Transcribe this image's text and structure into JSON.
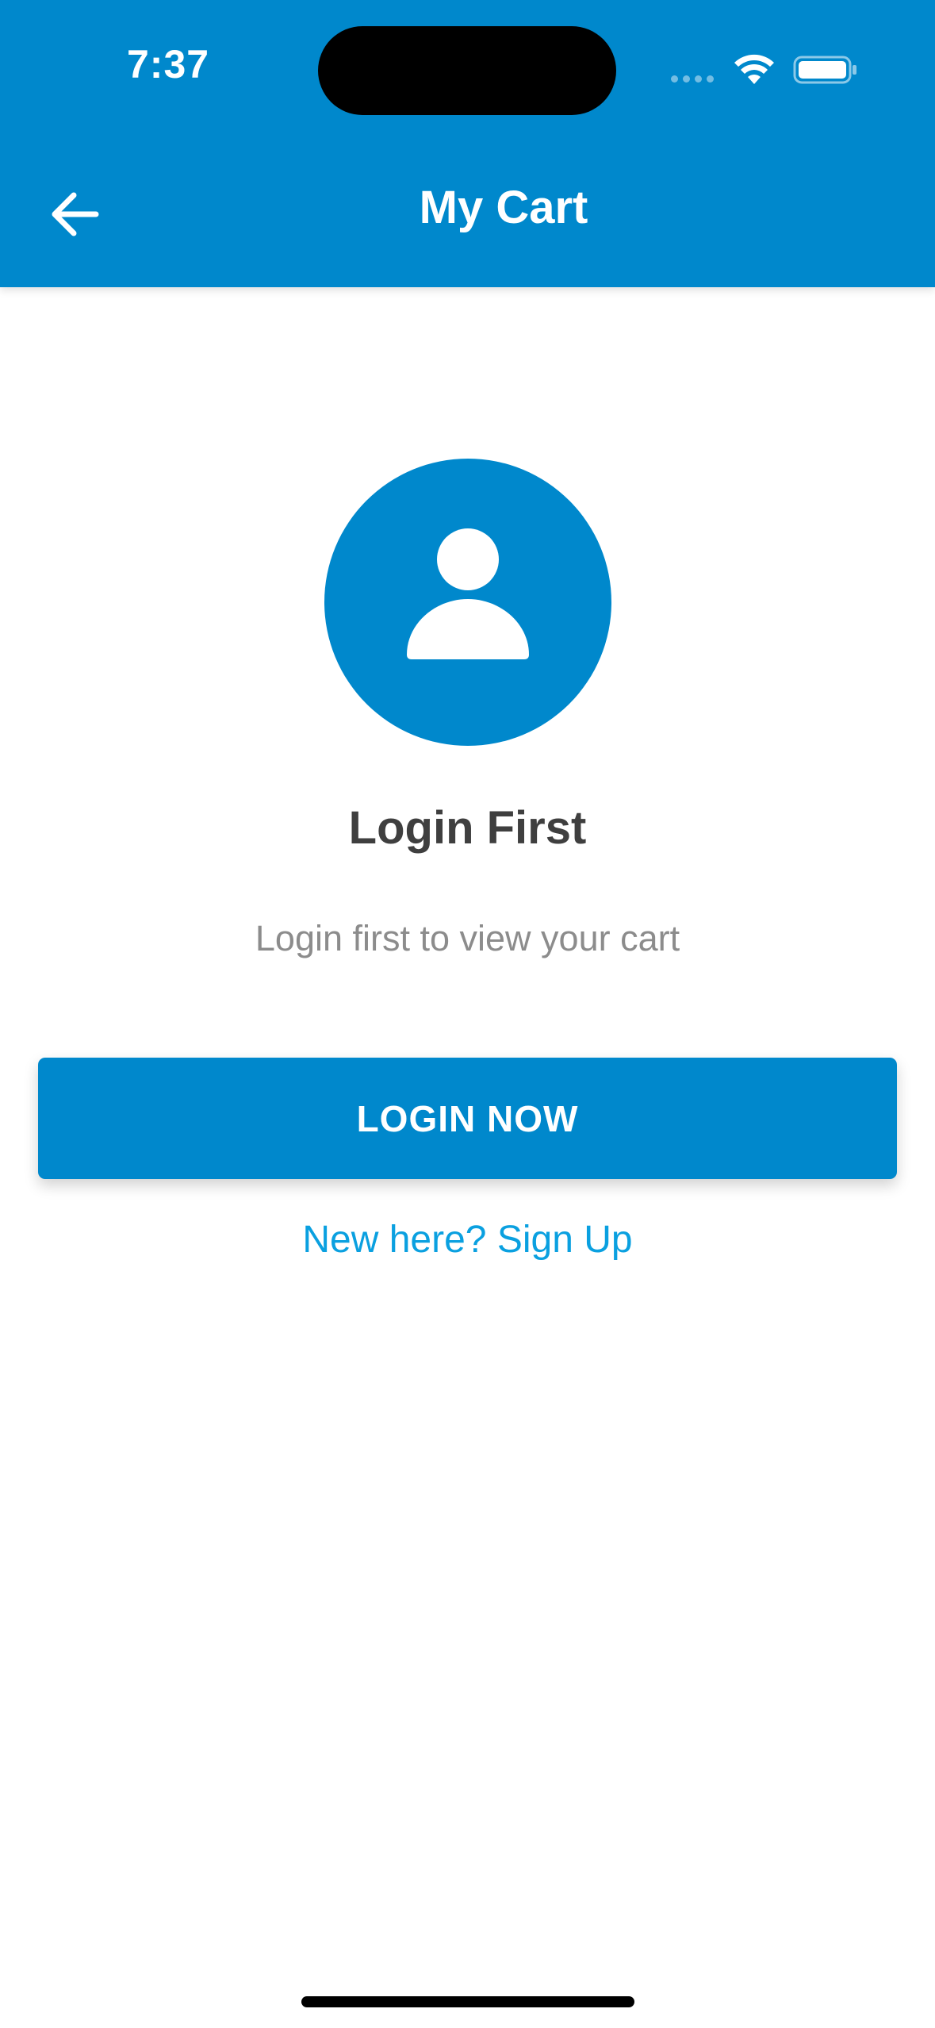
{
  "status_bar": {
    "time": "7:37",
    "icons": [
      "cellular-signal-icon",
      "wifi-icon",
      "battery-icon"
    ]
  },
  "header": {
    "title": "My Cart",
    "back_icon": "arrow-left-icon",
    "background_color": "#0088CC"
  },
  "main": {
    "avatar_icon": "user-icon",
    "heading": "Login First",
    "subtext": "Login first to view your cart",
    "login_button_label": "LOGIN NOW",
    "signup_link_label": "New here? Sign Up"
  },
  "colors": {
    "accent": "#0088CC",
    "link": "#0AA0E0",
    "heading": "#3F3F3F",
    "subtext": "#8C8C8C"
  }
}
